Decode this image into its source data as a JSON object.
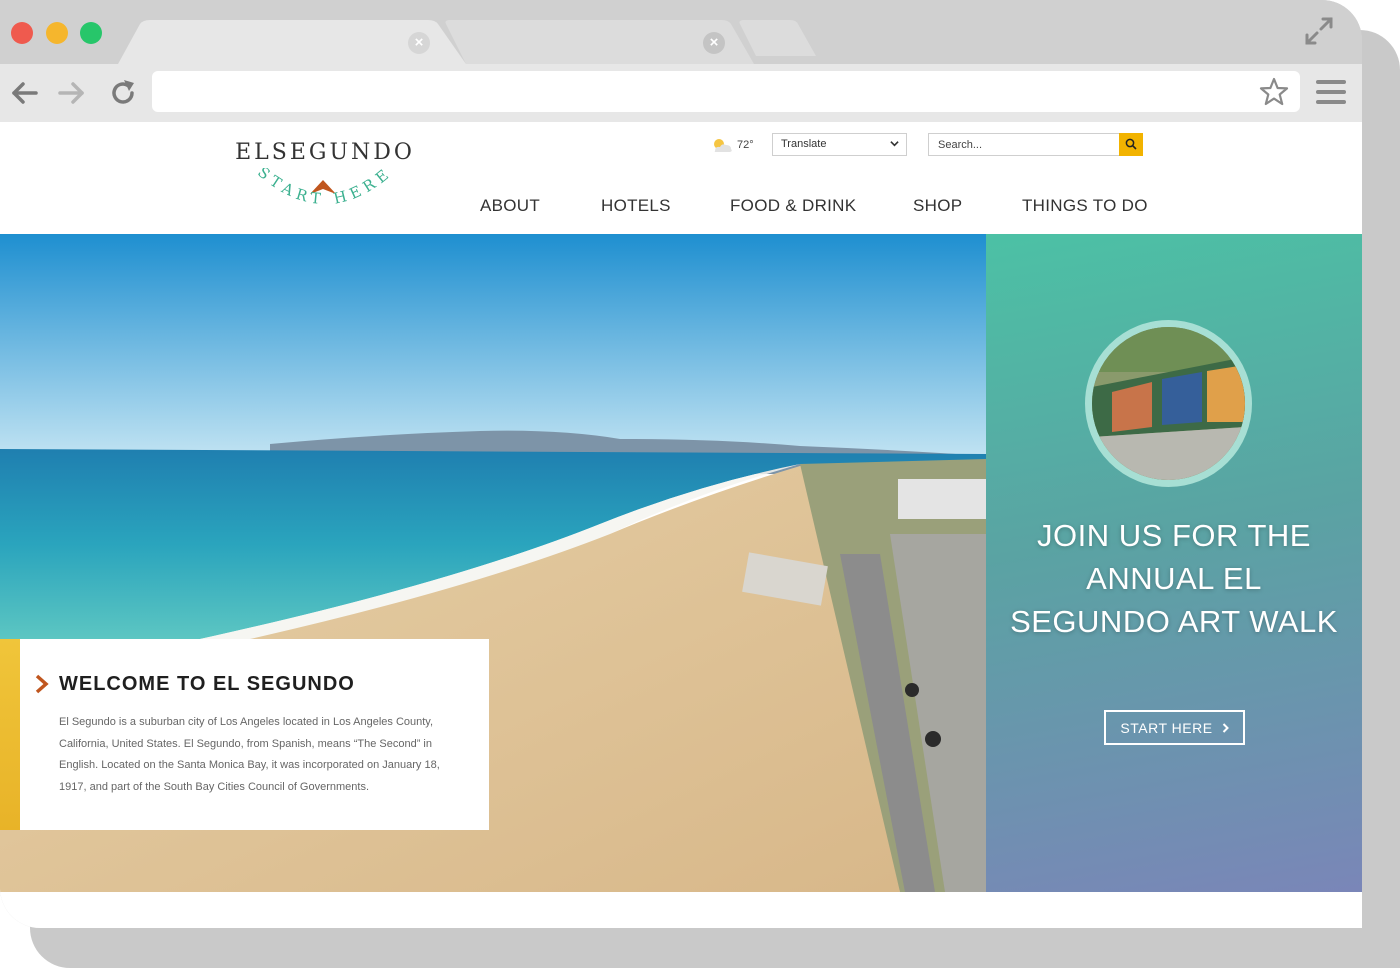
{
  "browser": {
    "tabs": [
      "",
      ""
    ],
    "address": "",
    "colors": {
      "frame": "#d0d0d0",
      "toolbar": "#e7e7e7",
      "close_red": "#ef5a4e",
      "min_yellow": "#f5b62d",
      "max_green": "#27c66a"
    }
  },
  "site": {
    "logo": {
      "title": "ELSEGUNDO",
      "tagline": "START HERE"
    },
    "weather": {
      "temp": "72°",
      "icon": "partly-cloudy-icon"
    },
    "translate": {
      "label": "Translate"
    },
    "search": {
      "placeholder": "Search..."
    },
    "nav": [
      {
        "label": "ABOUT"
      },
      {
        "label": "HOTELS"
      },
      {
        "label": "FOOD & DRINK"
      },
      {
        "label": "SHOP"
      },
      {
        "label": "THINGS TO DO"
      }
    ],
    "welcome": {
      "title": "WELCOME TO EL SEGUNDO",
      "body": "El Segundo is a suburban city of Los Angeles located in Los Angeles County, California, United States. El Segundo, from Spanish, means “The Second” in English. Located on the Santa Monica Bay, it was incorporated on January 18, 1917, and part of the South Bay Cities Council of Governments."
    },
    "promo": {
      "title": "JOIN US FOR THE ANNUAL EL SEGUNDO ART WALK",
      "button": "START HERE",
      "slides": 4,
      "active_slide": 2
    },
    "colors": {
      "accent_yellow": "#f2b300",
      "accent_orange": "#c0561e",
      "logo_teal": "#3bb08f"
    }
  }
}
